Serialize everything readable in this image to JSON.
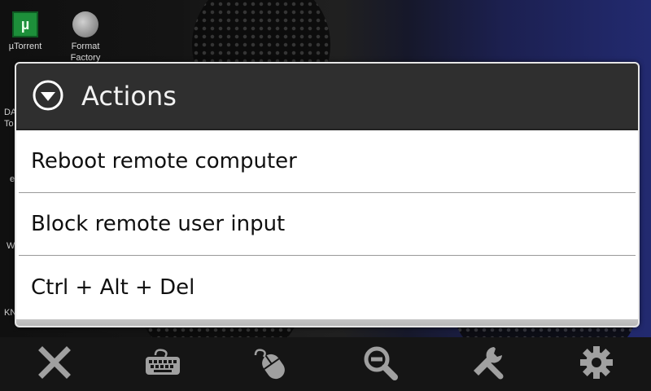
{
  "desktop": {
    "icons": [
      {
        "label": "µTorrent",
        "glyph": "µ"
      },
      {
        "label": "Format Factory"
      }
    ],
    "edge_texts": [
      "DA",
      "To",
      "e",
      "W",
      "KN"
    ]
  },
  "dialog": {
    "title": "Actions",
    "header_icon": "dropdown-circle-icon",
    "items": [
      {
        "label": "Reboot remote computer"
      },
      {
        "label": "Block remote user input"
      },
      {
        "label": "Ctrl + Alt + Del"
      }
    ]
  },
  "toolbar": {
    "buttons": [
      {
        "name": "close",
        "icon": "close-icon"
      },
      {
        "name": "keyboard",
        "icon": "keyboard-icon"
      },
      {
        "name": "mouse",
        "icon": "mouse-icon"
      },
      {
        "name": "zoom-out",
        "icon": "zoom-out-icon"
      },
      {
        "name": "tools",
        "icon": "wrench-icon"
      },
      {
        "name": "settings",
        "icon": "gear-icon"
      }
    ]
  },
  "colors": {
    "dialog_header": "#2f2f2f",
    "dialog_body": "#ffffff",
    "toolbar_bg": "#151515",
    "toolbar_icons": "#9a9a9a"
  }
}
